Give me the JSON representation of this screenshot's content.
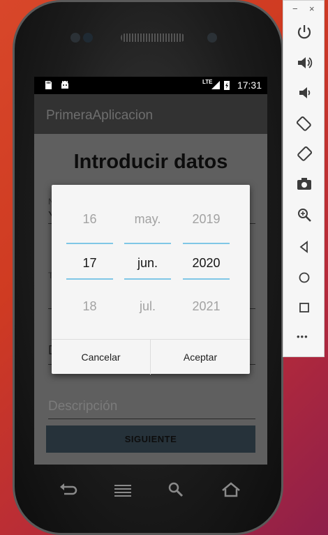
{
  "status": {
    "network": "LTE",
    "time": "17:31"
  },
  "app": {
    "title": "PrimeraAplicacion"
  },
  "form": {
    "heading": "Introducir datos",
    "field1_stub": "Y",
    "field2_stub": "Y",
    "field3_stub": "D",
    "description_placeholder": "Descripción",
    "next_button": "SIGUIENTE"
  },
  "date_picker": {
    "day": {
      "prev": "16",
      "selected": "17",
      "next": "18"
    },
    "month": {
      "prev": "may.",
      "selected": "jun.",
      "next": "jul."
    },
    "year": {
      "prev": "2019",
      "selected": "2020",
      "next": "2021"
    },
    "cancel": "Cancelar",
    "accept": "Aceptar"
  },
  "emulator_panel": {
    "minimize": "−",
    "close": "×",
    "controls": [
      "power-icon",
      "volume-up-icon",
      "volume-down-icon",
      "rotate-left-icon",
      "rotate-right-icon",
      "camera-icon",
      "zoom-icon",
      "back-icon",
      "home-icon",
      "overview-icon",
      "more-icon"
    ],
    "more": "•••"
  },
  "colors": {
    "accent_divider": "#7fc7e6",
    "next_button_bg": "#26323a",
    "dialog_bg": "#f5f5f5"
  }
}
